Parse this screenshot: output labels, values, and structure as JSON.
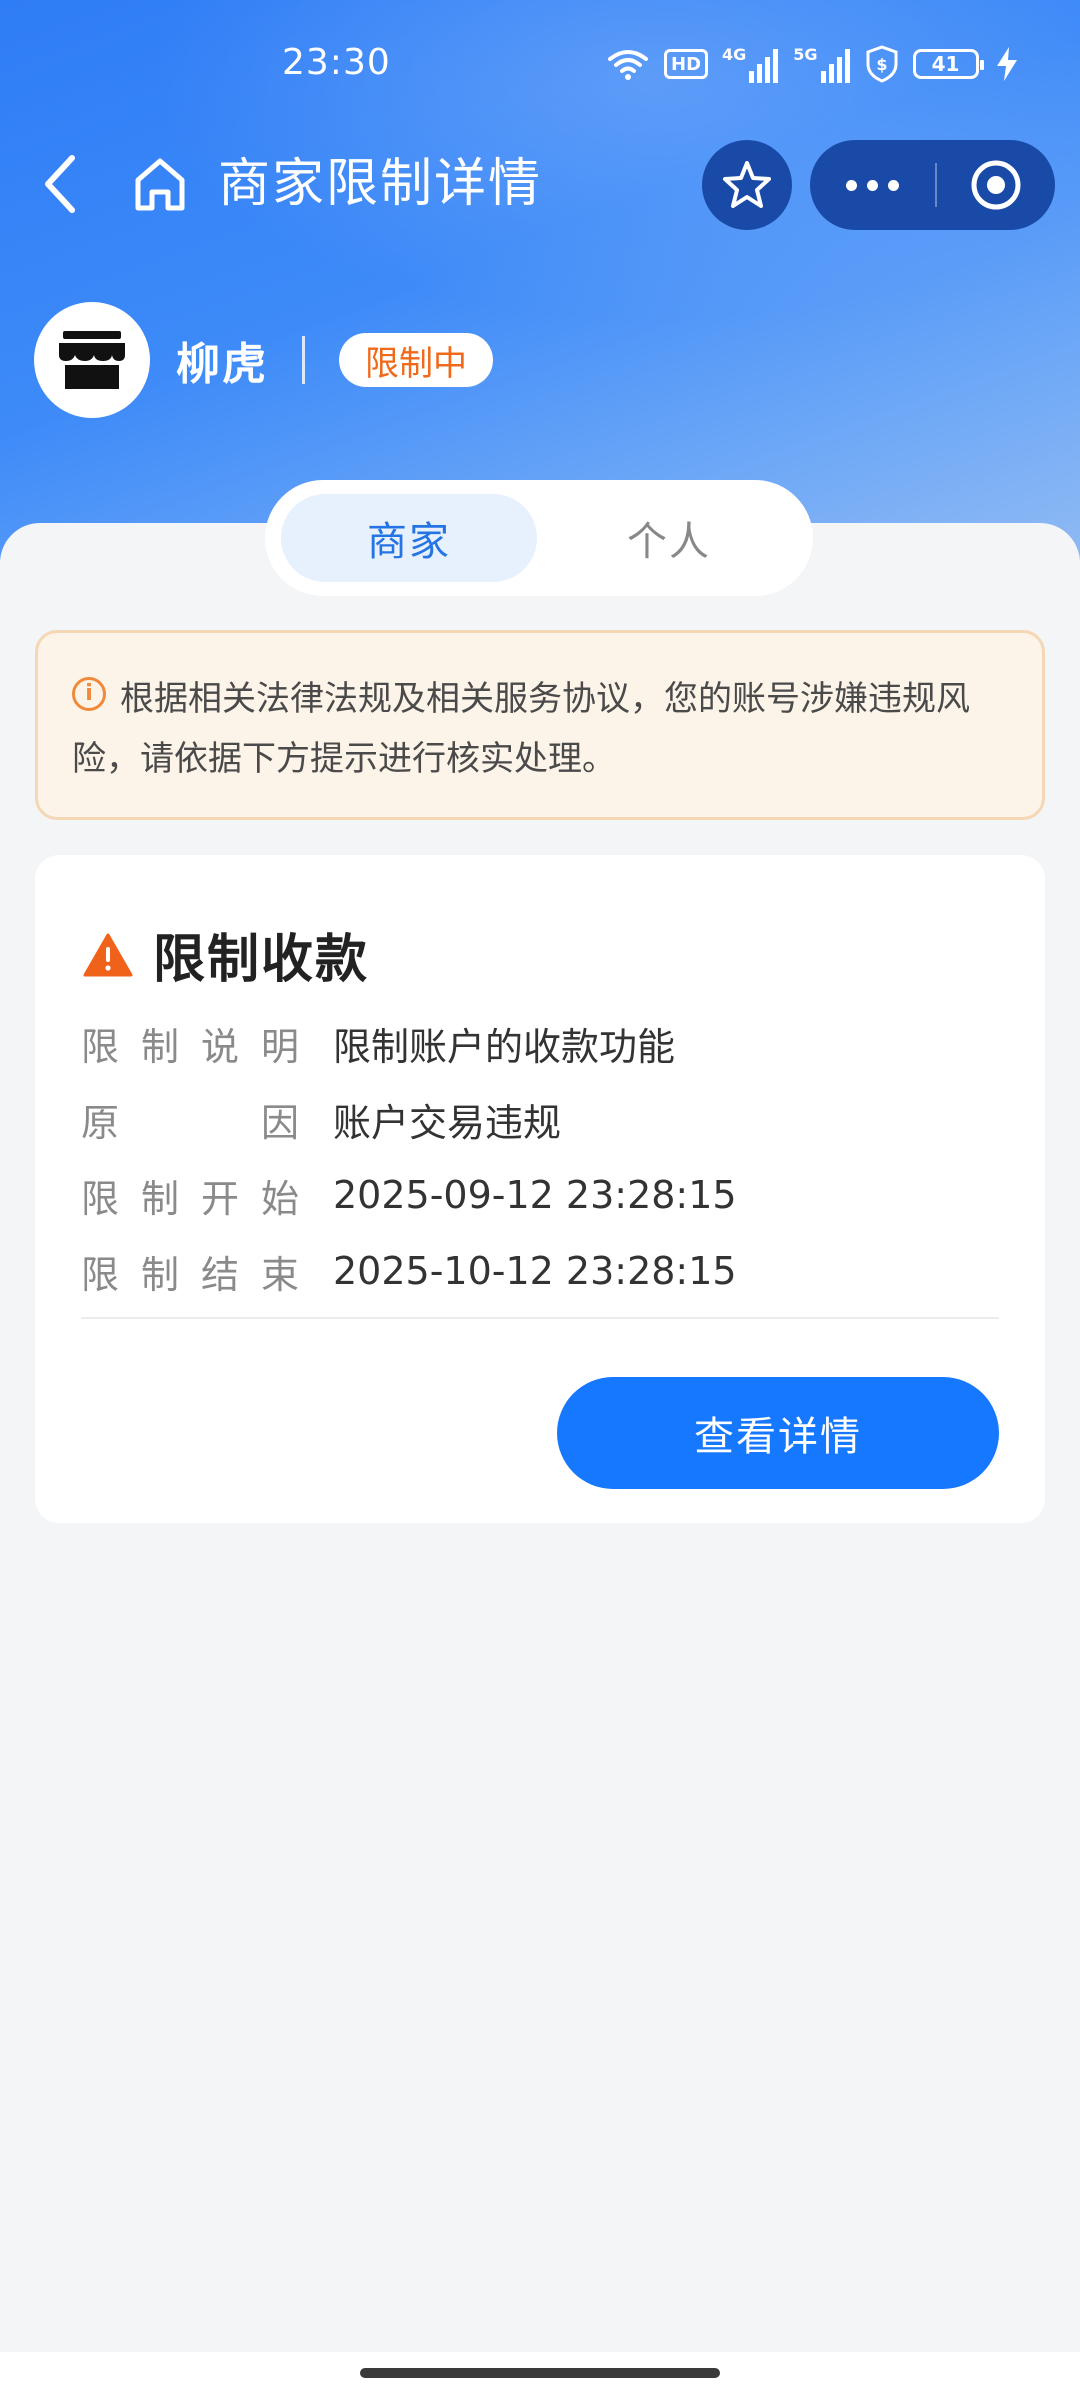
{
  "status_bar": {
    "time": "23:30",
    "icons": [
      "wifi-icon",
      "hd-icon",
      "signal-4g-icon",
      "signal-5g-icon",
      "shield-dollar-icon",
      "battery-icon",
      "charging-icon"
    ],
    "hd_label": "HD",
    "net1_label": "4G",
    "net2_label": "5G",
    "battery_level": "41"
  },
  "nav": {
    "title": "商家限制详情",
    "icons": [
      "back-icon",
      "home-icon",
      "star-icon",
      "more-icon",
      "close-circle-icon"
    ]
  },
  "merchant": {
    "name": "柳虎",
    "status": "限制中",
    "avatar_icon": "store-icon"
  },
  "tabs": [
    {
      "label": "商家",
      "active": true
    },
    {
      "label": "个人",
      "active": false
    }
  ],
  "notice": {
    "icon": "info-icon",
    "text": "根据相关法律法规及相关服务协议，您的账号涉嫌违规风险，请依据下方提示进行核实处理。"
  },
  "restriction": {
    "icon": "warning-icon",
    "title": "限制收款",
    "rows": [
      {
        "label_chars": [
          "限",
          "制",
          "说",
          "明"
        ],
        "value": "限制账户的收款功能"
      },
      {
        "label_chars": [
          "原",
          "因"
        ],
        "value": "账户交易违规"
      },
      {
        "label_chars": [
          "限",
          "制",
          "开",
          "始"
        ],
        "value": "2025-09-12 23:28:15"
      },
      {
        "label_chars": [
          "限",
          "制",
          "结",
          "束"
        ],
        "value": "2025-10-12 23:28:15"
      }
    ],
    "button_label": "查看详情"
  },
  "colors": {
    "primary": "#1677ff",
    "badge_text": "#f06a1a",
    "notice_bg": "#fdf4e9",
    "warning": "#f0621a"
  }
}
